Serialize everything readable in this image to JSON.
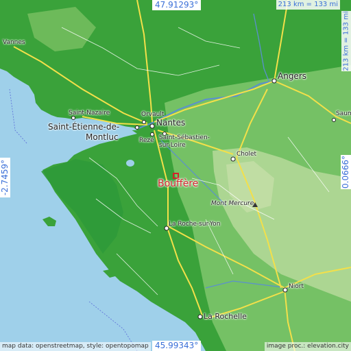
{
  "map": {
    "target": "Bouffère",
    "coords": {
      "top": "47.91293°",
      "bottom": "45.99343°",
      "left": "-2.7459°",
      "right": "0.0666°"
    },
    "scale": {
      "horizontal": "213 km = 133 mi",
      "vertical": "213 km = 133 mi"
    },
    "attribution": {
      "left": "map data: openstreetmap, style: opentopomap",
      "right": "image proc.: elevation.city"
    },
    "places": {
      "vannes": "Vannes",
      "angers": "Angers",
      "saint_nazaire": "Saint-Nazaire",
      "orvault": "Orvault",
      "nantes": "Nantes",
      "saint_etienne_1": "Saint-Étienne-de-",
      "saint_etienne_2": "Montluc",
      "reze": "Rezé",
      "saint_sebastien_1": "Saint-Sébastien-",
      "saint_sebastien_2": "sur-Loire",
      "cholet": "Cholet",
      "saumur": "Saum",
      "mont_mercure": "Mont Mercure",
      "la_roche": "La Roche-sur-Yon",
      "niort": "Niort",
      "la_rochelle": "La Rochelle"
    },
    "colors": {
      "sea": "#9fd0ea",
      "lowland": "#3aa23a",
      "midland": "#7cc46a",
      "upland": "#b6d99a",
      "road_major": "#f3e04a",
      "road_other": "#ffffff",
      "river": "#5b8fd0",
      "target": "#d2232a"
    }
  }
}
